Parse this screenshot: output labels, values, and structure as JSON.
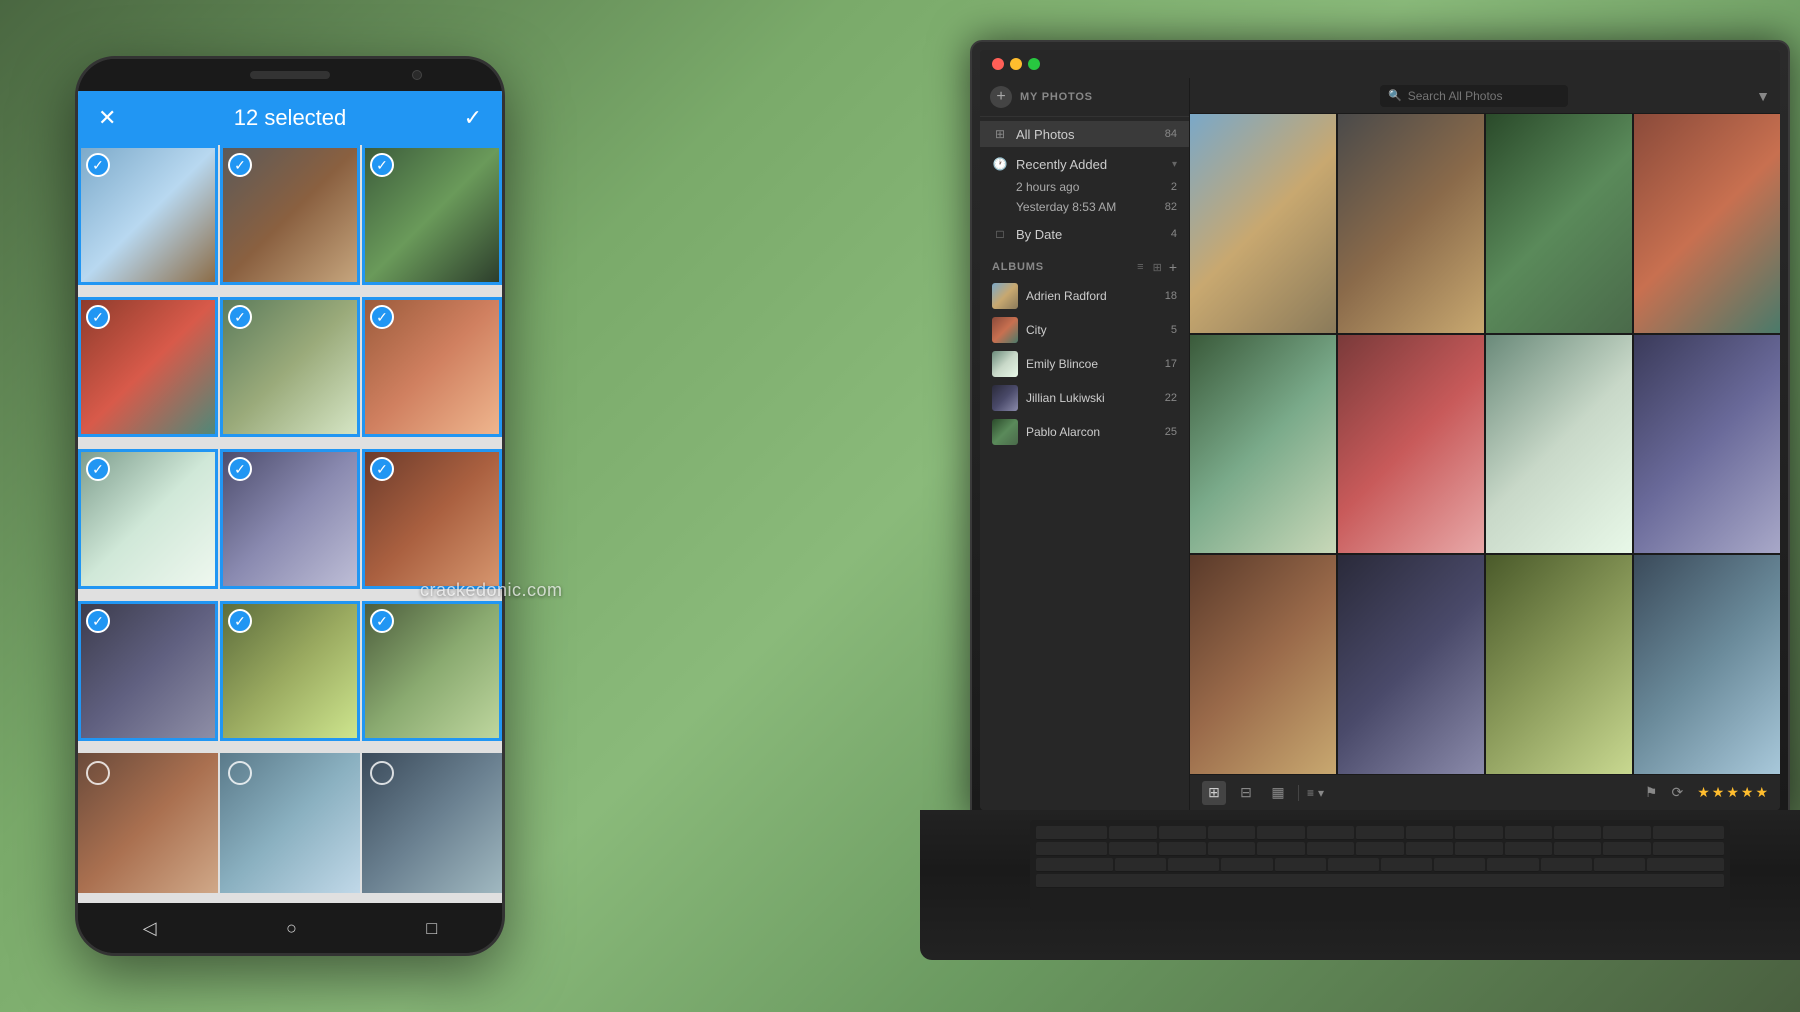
{
  "background": {
    "color": "#5a7a5a"
  },
  "phone": {
    "selected_count": "12 selected",
    "header_close": "✕",
    "header_check": "✓",
    "photos": [
      {
        "id": 1,
        "selected": true,
        "color_class": "ph1"
      },
      {
        "id": 2,
        "selected": true,
        "color_class": "ph2"
      },
      {
        "id": 3,
        "selected": true,
        "color_class": "ph3"
      },
      {
        "id": 4,
        "selected": true,
        "color_class": "ph4"
      },
      {
        "id": 5,
        "selected": true,
        "color_class": "ph5"
      },
      {
        "id": 6,
        "selected": true,
        "color_class": "ph6"
      },
      {
        "id": 7,
        "selected": true,
        "color_class": "ph7"
      },
      {
        "id": 8,
        "selected": true,
        "color_class": "ph8"
      },
      {
        "id": 9,
        "selected": true,
        "color_class": "ph9"
      },
      {
        "id": 10,
        "selected": true,
        "color_class": "ph10"
      },
      {
        "id": 11,
        "selected": true,
        "color_class": "ph11"
      },
      {
        "id": 12,
        "selected": true,
        "color_class": "ph12"
      },
      {
        "id": 13,
        "selected": false,
        "color_class": "ph13"
      },
      {
        "id": 14,
        "selected": false,
        "color_class": "ph14"
      },
      {
        "id": 15,
        "selected": false,
        "color_class": "ph15"
      }
    ]
  },
  "watermark": {
    "text": "crackedonic.com"
  },
  "laptop": {
    "traffic_lights": {
      "red": "close",
      "yellow": "minimize",
      "green": "maximize"
    },
    "search": {
      "placeholder": "Search All Photos",
      "icon": "🔍"
    },
    "filter_icon": "▼",
    "sidebar": {
      "my_photos_label": "MY PHOTOS",
      "add_button": "+",
      "all_photos": {
        "label": "All Photos",
        "count": "84",
        "icon": "⊞"
      },
      "recently_added": {
        "label": "Recently Added",
        "expand_icon": "▾",
        "sub_items": [
          {
            "label": "2 hours ago",
            "count": "2"
          },
          {
            "label": "Yesterday 8:53 AM",
            "count": "82"
          }
        ]
      },
      "by_date": {
        "label": "By Date",
        "count": "4",
        "icon": "□"
      },
      "albums_section": {
        "title": "ALBUMS",
        "view_list": "≡",
        "view_grid": "⊞",
        "add": "+",
        "items": [
          {
            "name": "Adrien Radford",
            "count": "18"
          },
          {
            "name": "City",
            "count": "5"
          },
          {
            "name": "Emily Blincoe",
            "count": "17"
          },
          {
            "name": "Jillian Lukiwski",
            "count": "22"
          },
          {
            "name": "Pablo Alarcon",
            "count": "25"
          }
        ]
      }
    },
    "main_grid": {
      "photos": [
        {
          "id": 1,
          "color_class": "p1"
        },
        {
          "id": 2,
          "color_class": "p2"
        },
        {
          "id": 3,
          "color_class": "p3"
        },
        {
          "id": 4,
          "color_class": "p4"
        },
        {
          "id": 5,
          "color_class": "p5"
        },
        {
          "id": 6,
          "color_class": "p6"
        },
        {
          "id": 7,
          "color_class": "p7"
        },
        {
          "id": 8,
          "color_class": "p8"
        },
        {
          "id": 9,
          "color_class": "p9"
        },
        {
          "id": 10,
          "color_class": "p10"
        },
        {
          "id": 11,
          "color_class": "p11"
        },
        {
          "id": 12,
          "color_class": "p12"
        }
      ]
    },
    "toolbar": {
      "view_large": "⊞",
      "view_medium": "⊟",
      "view_small": "▦",
      "sort_icon": "≡",
      "sort_arrow": "▾",
      "flag_icon": "⚑",
      "rotate_icon": "⟳",
      "stars": [
        "★",
        "★",
        "★",
        "★",
        "★"
      ]
    }
  }
}
